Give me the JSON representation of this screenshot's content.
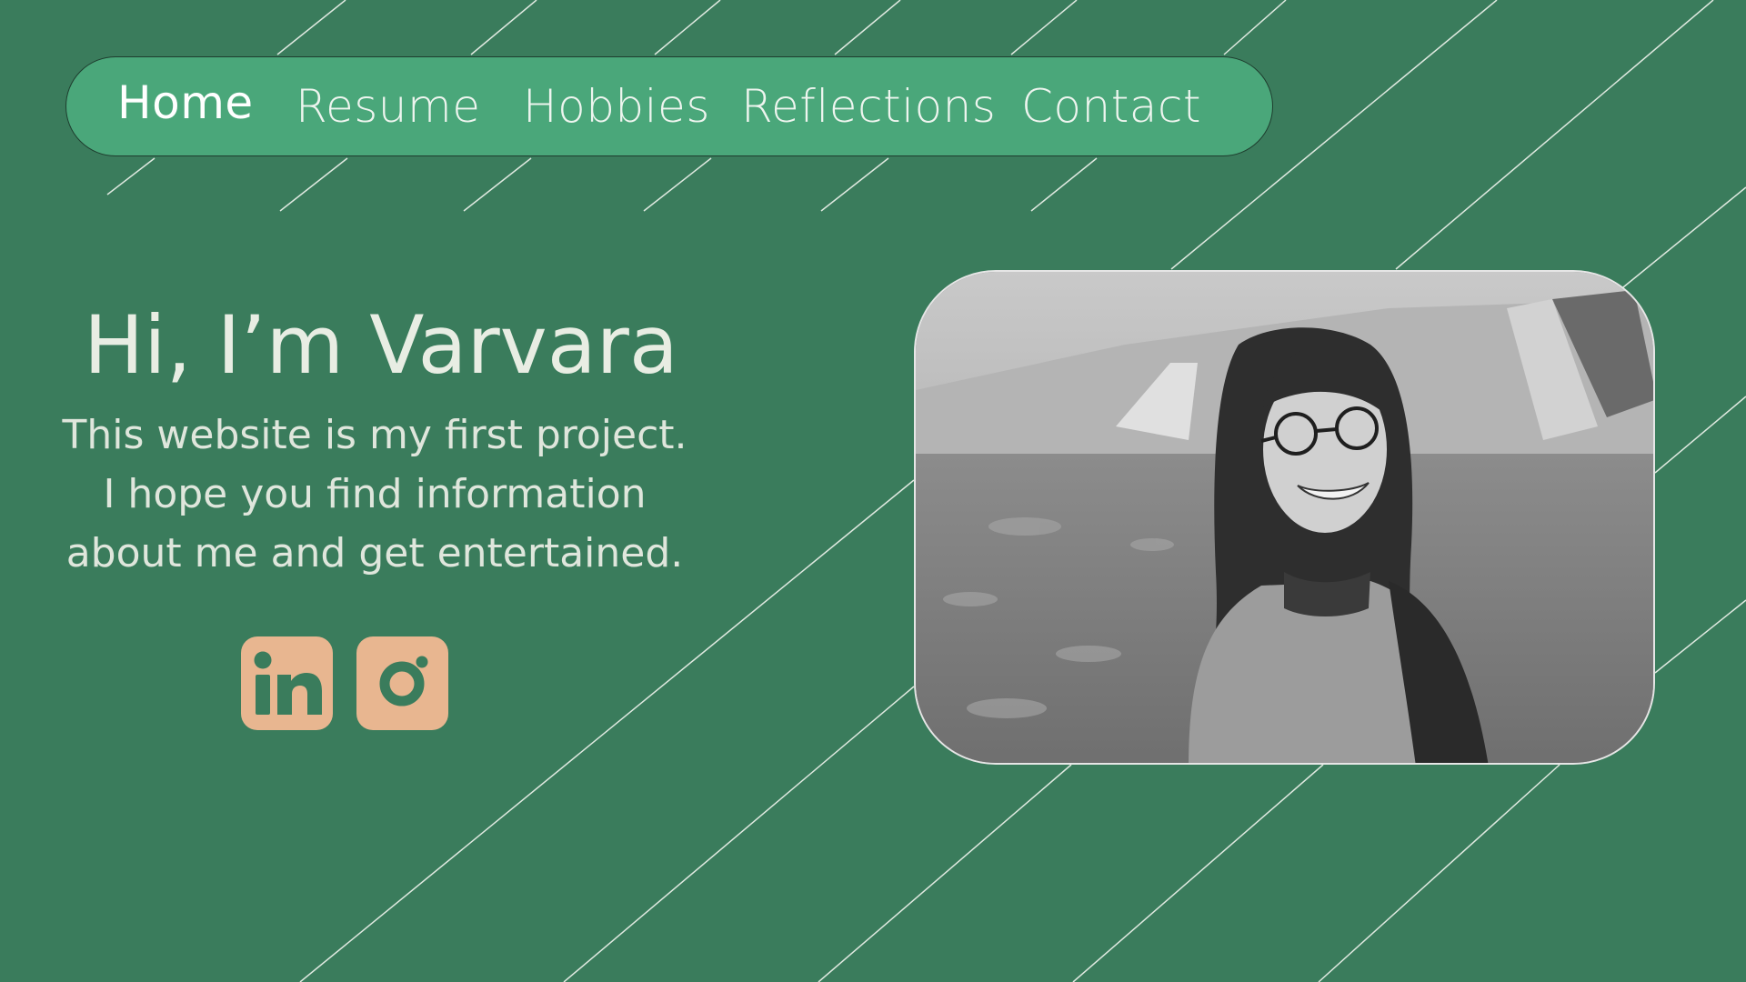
{
  "nav": {
    "home": "Home",
    "resume": "Resume",
    "hobbies": "Hobbies",
    "reflections": "Reflections",
    "contact": "Contact"
  },
  "hero": {
    "title": "Hi, I’m Varvara",
    "lines": [
      "This website is my first project.",
      "I hope you find information",
      "about me and get entertained."
    ]
  },
  "social": [
    {
      "icon": "linkedin-icon"
    },
    {
      "icon": "instagram-icon"
    }
  ],
  "colors": {
    "background": "#3a7c5c",
    "navbar": "#4aa77a",
    "text": "#e8ede3",
    "social_bg": "#e8b690"
  }
}
